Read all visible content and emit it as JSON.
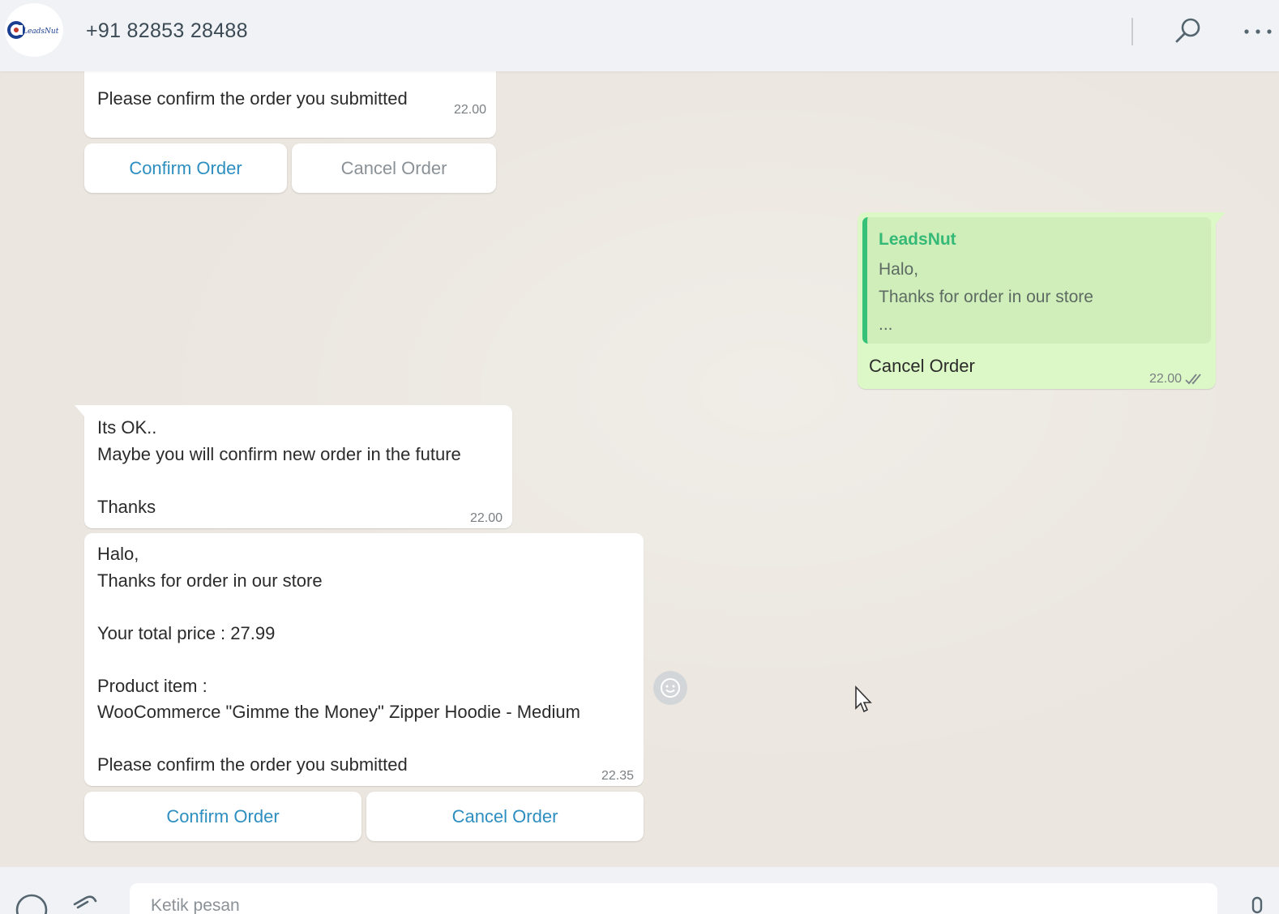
{
  "header": {
    "avatar_logo_text": "LeadsNut",
    "contact_name": "+91 82853 28488",
    "icons": [
      "search-icon",
      "more-options-icon"
    ]
  },
  "messages": [
    {
      "id": "order-1-partial",
      "direction": "incoming",
      "text": "Please confirm the order you submitted",
      "time": "22.00",
      "buttons": [
        {
          "label": "Confirm Order"
        },
        {
          "label": "Cancel Order",
          "state": "used"
        }
      ]
    },
    {
      "id": "reply-cancel",
      "direction": "outgoing",
      "quoted": {
        "author": "LeadsNut",
        "text": "Halo,\nThanks for order in our store\n..."
      },
      "text": "Cancel Order",
      "time": "22.00",
      "status_icon": "double-check-icon"
    },
    {
      "id": "its-ok",
      "direction": "incoming",
      "text": "Its OK..\nMaybe you will confirm new order in the future\n\nThanks",
      "time": "22.00"
    },
    {
      "id": "order-2",
      "direction": "incoming",
      "text": "Halo,\nThanks for order in our store\n\nYour total price :  27.99\n\nProduct item :\nWooCommerce \"Gimme the Money\" Zipper Hoodie - Medium\n\nPlease confirm the order you submitted",
      "time": "22.35",
      "buttons": [
        {
          "label": "Confirm Order"
        },
        {
          "label": "Cancel Order"
        }
      ]
    }
  ],
  "composer": {
    "placeholder": "Ketik pesan",
    "icons": [
      "emoji-icon",
      "paperclip-icon",
      "microphone-icon"
    ]
  },
  "colors": {
    "accent_link": "#2d8ec0",
    "outgoing_bubble": "#dcf8c6",
    "quote_bar": "#35c177",
    "chat_background": "#ebe6df",
    "header_background": "#f0f2f5"
  }
}
